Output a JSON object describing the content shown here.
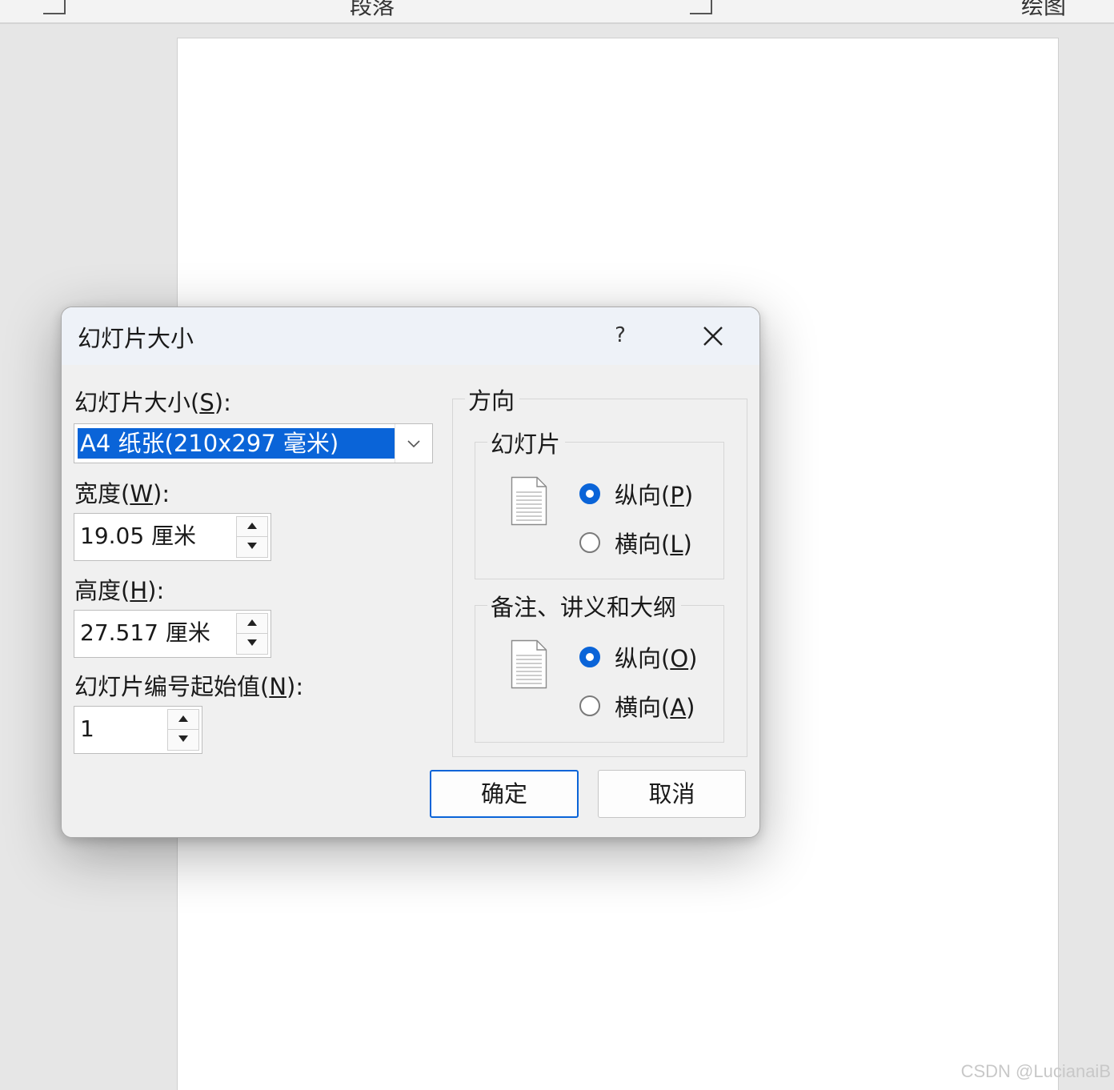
{
  "ribbon": {
    "groups": [
      "段落",
      "绘图"
    ]
  },
  "watermark": "CSDN @LucianaiB",
  "dialog": {
    "title": "幻灯片大小",
    "help_label": "?",
    "slide_size": {
      "label_prefix": "幻灯片大小(",
      "label_key": "S",
      "label_suffix": "):",
      "value": "A4 纸张(210x297 毫米)"
    },
    "width": {
      "label_prefix": "宽度(",
      "label_key": "W",
      "label_suffix": "):",
      "value": "19.05 厘米"
    },
    "height": {
      "label_prefix": "高度(",
      "label_key": "H",
      "label_suffix": "):",
      "value": "27.517 厘米"
    },
    "numbering": {
      "label_prefix": "幻灯片编号起始值(",
      "label_key": "N",
      "label_suffix": "):",
      "value": "1"
    },
    "orientation": {
      "title": "方向",
      "slides": {
        "title": "幻灯片",
        "portrait": {
          "prefix": "纵向(",
          "key": "P",
          "suffix": ")",
          "selected": true
        },
        "landscape": {
          "prefix": "横向(",
          "key": "L",
          "suffix": ")",
          "selected": false
        }
      },
      "notes": {
        "title": "备注、讲义和大纲",
        "portrait": {
          "prefix": "纵向(",
          "key": "O",
          "suffix": ")",
          "selected": true
        },
        "landscape": {
          "prefix": "横向(",
          "key": "A",
          "suffix": ")",
          "selected": false
        }
      }
    },
    "ok_label": "确定",
    "cancel_label": "取消"
  },
  "colors": {
    "accent": "#0a64d8",
    "dialog_bg": "#f0f0f0",
    "titlebar_bg": "#eef2f8"
  }
}
